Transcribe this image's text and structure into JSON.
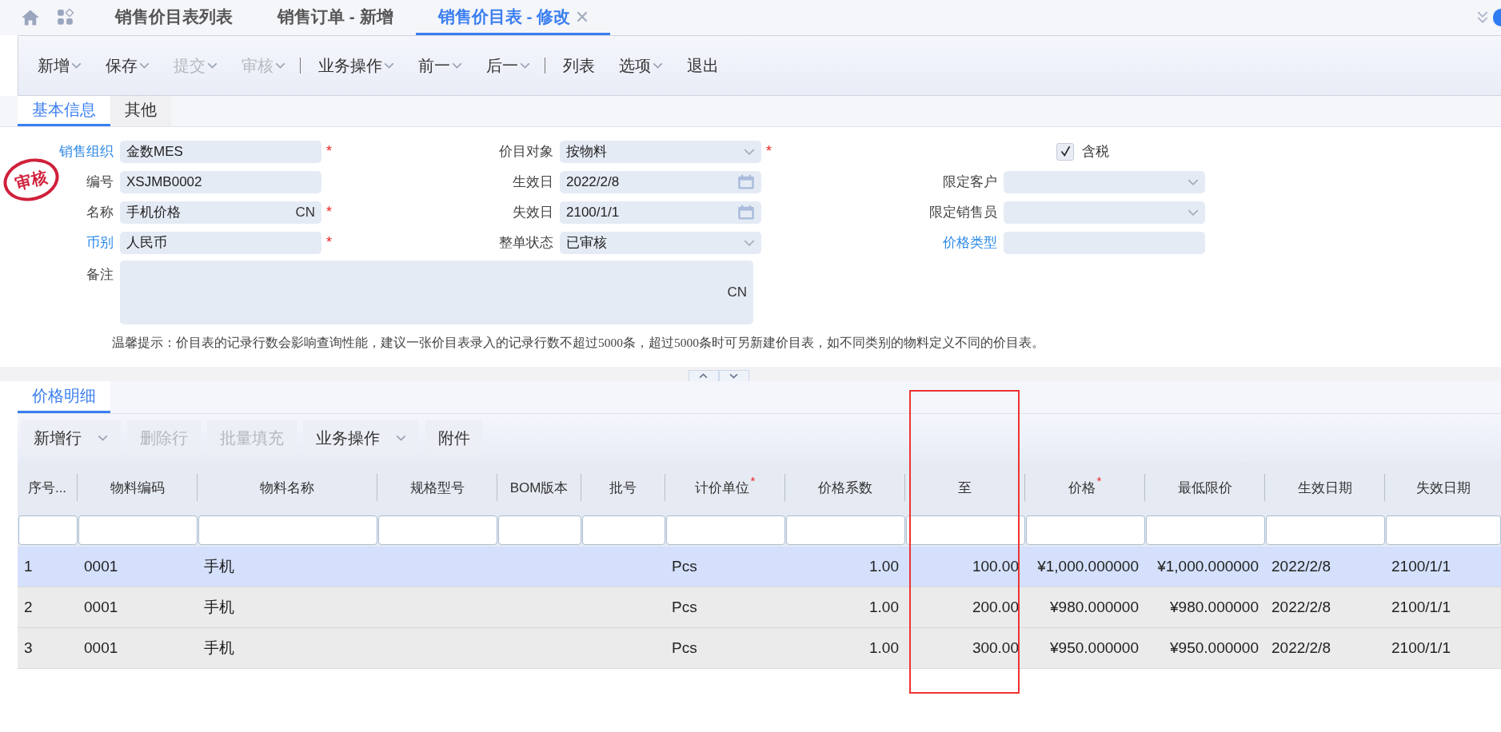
{
  "top_tabs": [
    {
      "label": "销售价目表列表",
      "selected": false,
      "closable": false
    },
    {
      "label": "销售订单 - 新增",
      "selected": false,
      "closable": false
    },
    {
      "label": "销售价目表 - 修改",
      "selected": true,
      "closable": true
    }
  ],
  "toolbar": [
    {
      "kind": "button",
      "label": "新增",
      "disabled": false,
      "dropdown": true
    },
    {
      "kind": "button",
      "label": "保存",
      "disabled": false,
      "dropdown": true
    },
    {
      "kind": "button",
      "label": "提交",
      "disabled": true,
      "dropdown": true
    },
    {
      "kind": "button",
      "label": "审核",
      "disabled": true,
      "dropdown": true
    },
    {
      "kind": "separator"
    },
    {
      "kind": "button",
      "label": "业务操作",
      "disabled": false,
      "dropdown": true
    },
    {
      "kind": "button",
      "label": "前一",
      "disabled": false,
      "dropdown": true
    },
    {
      "kind": "button",
      "label": "后一",
      "disabled": false,
      "dropdown": true
    },
    {
      "kind": "separator"
    },
    {
      "kind": "button",
      "label": "列表",
      "disabled": false,
      "dropdown": false
    },
    {
      "kind": "button",
      "label": "选项",
      "disabled": false,
      "dropdown": true
    },
    {
      "kind": "button",
      "label": "退出",
      "disabled": false,
      "dropdown": false
    }
  ],
  "form_tabs": [
    {
      "label": "基本信息",
      "selected": true
    },
    {
      "label": "其他",
      "selected": false
    }
  ],
  "stamp": "审核",
  "required_mark": "*",
  "form_columns": [
    [
      {
        "label": "销售组织",
        "link": true,
        "kind": "text",
        "value": "金数MES",
        "required": true
      },
      {
        "label": "编号",
        "link": false,
        "kind": "text",
        "value": "XSJMB0002",
        "required": false
      },
      {
        "label": "名称",
        "link": false,
        "kind": "text",
        "value": "手机价格",
        "suffix": "CN",
        "required": true
      },
      {
        "label": "币别",
        "link": true,
        "kind": "text",
        "value": "人民币",
        "required": true
      }
    ],
    [
      {
        "label": "价目对象",
        "link": false,
        "kind": "select",
        "value": "按物料",
        "required": true
      },
      {
        "label": "生效日",
        "link": false,
        "kind": "date",
        "value": "2022/2/8",
        "required": false
      },
      {
        "label": "失效日",
        "link": false,
        "kind": "date",
        "value": "2100/1/1",
        "required": false
      },
      {
        "label": "整单状态",
        "link": false,
        "kind": "select",
        "value": "已审核",
        "required": false
      }
    ],
    [
      {
        "label": "含税",
        "kind": "checkbox",
        "checked": true
      },
      {
        "label": "限定客户",
        "link": false,
        "kind": "select",
        "required": false
      },
      {
        "label": "限定销售员",
        "link": false,
        "kind": "select",
        "required": false
      },
      {
        "label": "价格类型",
        "link": true,
        "kind": "text",
        "required": false
      }
    ]
  ],
  "remarks": {
    "label": "备注",
    "suffix": "CN"
  },
  "hint": "温馨提示：价目表的记录行数会影响查询性能，建议一张价目表录入的记录行数不超过5000条，超过5000条时可另新建价目表，如不同类别的物料定义不同的价目表。",
  "detail_tabs": [
    {
      "label": "价格明细",
      "selected": true
    }
  ],
  "grid_toolbar": [
    {
      "label": "新增行",
      "disabled": false,
      "dropdown": true
    },
    {
      "label": "删除行",
      "disabled": true,
      "dropdown": false
    },
    {
      "label": "批量填充",
      "disabled": true,
      "dropdown": false
    },
    {
      "label": "业务操作",
      "disabled": false,
      "dropdown": true
    },
    {
      "label": "附件",
      "disabled": false,
      "dropdown": false
    }
  ],
  "table": {
    "columns": [
      {
        "label": "序号...",
        "required": false,
        "highlighted": false
      },
      {
        "label": "物料编码",
        "required": false,
        "highlighted": false
      },
      {
        "label": "物料名称",
        "required": false,
        "highlighted": false
      },
      {
        "label": "规格型号",
        "required": false,
        "highlighted": false
      },
      {
        "label": "BOM版本",
        "required": false,
        "highlighted": false
      },
      {
        "label": "批号",
        "required": false,
        "highlighted": false
      },
      {
        "label": "计价单位",
        "required": true,
        "highlighted": false
      },
      {
        "label": "价格系数",
        "required": false,
        "highlighted": false
      },
      {
        "label": "至",
        "required": false,
        "highlighted": true
      },
      {
        "label": "价格",
        "required": true,
        "highlighted": false
      },
      {
        "label": "最低限价",
        "required": false,
        "highlighted": false
      },
      {
        "label": "生效日期",
        "required": false,
        "highlighted": false
      },
      {
        "label": "失效日期",
        "required": false,
        "highlighted": false
      }
    ],
    "rows": [
      {
        "selected": true,
        "cells": [
          "1",
          "0001",
          "手机",
          null,
          null,
          null,
          "Pcs",
          "1.00",
          "100.00",
          "¥1,000.000000",
          "¥1,000.000000",
          "2022/2/8",
          "2100/1/1"
        ]
      },
      {
        "selected": false,
        "cells": [
          "2",
          "0001",
          "手机",
          null,
          null,
          null,
          "Pcs",
          "1.00",
          "200.00",
          "¥980.000000",
          "¥980.000000",
          "2022/2/8",
          "2100/1/1"
        ]
      },
      {
        "selected": false,
        "cells": [
          "3",
          "0001",
          "手机",
          null,
          null,
          null,
          "Pcs",
          "1.00",
          "300.00",
          "¥950.000000",
          "¥950.000000",
          "2022/2/8",
          "2100/1/1"
        ]
      }
    ]
  }
}
